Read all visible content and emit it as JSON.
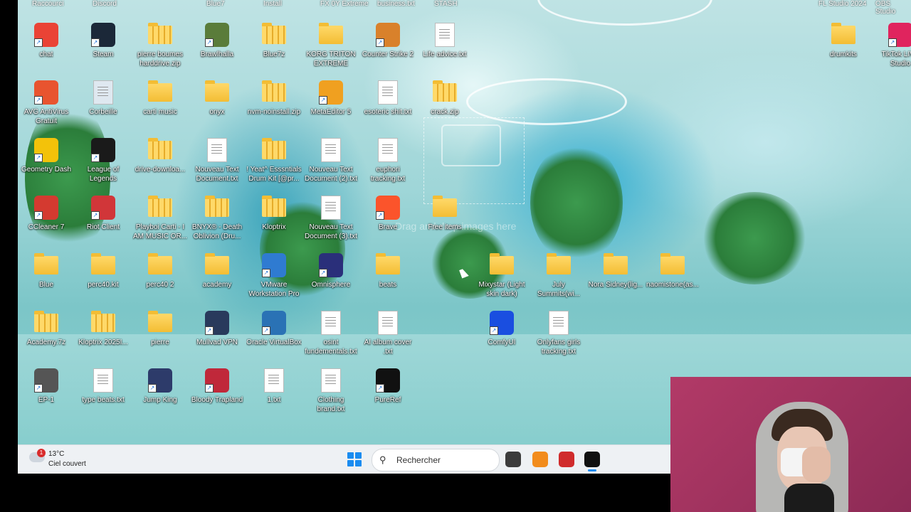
{
  "desktop": {
    "partial_top_labels": [
      {
        "text": "Raccourci"
      },
      {
        "text": "Discord"
      },
      {
        "text": "Blue7"
      },
      {
        "text": "Install"
      },
      {
        "text": "FX 0Y Extreme"
      },
      {
        "text": "business.txt"
      },
      {
        "text": "STASH"
      },
      {
        "text": "FL Studio 2024"
      },
      {
        "text": "OBS Studio"
      }
    ],
    "icons": [
      {
        "label": "chat",
        "type": "app",
        "color": "#ea4335"
      },
      {
        "label": "Steam",
        "type": "app",
        "color": "#1b2838"
      },
      {
        "label": "pierre boumes harddrive.zip",
        "type": "zip"
      },
      {
        "label": "Brawlhalla",
        "type": "app",
        "color": "#5a7c3a"
      },
      {
        "label": "Blue7z",
        "type": "zip"
      },
      {
        "label": "KORG TRITON EXTREME v1.0...",
        "type": "folder"
      },
      {
        "label": "Counter Strike 2",
        "type": "app",
        "color": "#d9812b"
      },
      {
        "label": "Life advice.txt",
        "type": "txt"
      },
      {
        "label": "drumkits",
        "type": "folder"
      },
      {
        "label": "TikTok LIVE Studio",
        "type": "app",
        "color": "#e0245e"
      },
      {
        "label": "AVG AntiVirus Gratuit",
        "type": "app",
        "color": "#e8542f"
      },
      {
        "label": "Corbeille",
        "type": "bin"
      },
      {
        "label": "carti music",
        "type": "folder"
      },
      {
        "label": "onyx",
        "type": "folder"
      },
      {
        "label": "nvm-noinstall.zip",
        "type": "zip"
      },
      {
        "label": "MetaEditor 5",
        "type": "app",
        "color": "#f0a020"
      },
      {
        "label": "esoteric shit.txt",
        "type": "txt"
      },
      {
        "label": "crack.zip",
        "type": "zip"
      },
      {
        "label": "Geometry Dash",
        "type": "app",
        "color": "#f3c20a"
      },
      {
        "label": "League of Legends",
        "type": "app",
        "color": "#1a1a1a"
      },
      {
        "label": "drive-downloa...",
        "type": "zip"
      },
      {
        "label": "Nouveau Text Document.txt",
        "type": "txt"
      },
      {
        "label": "! Yeat^ Esssntials Drum Kit [@pr...",
        "type": "zip"
      },
      {
        "label": "Nouveau Text Document (2).txt",
        "type": "txt"
      },
      {
        "label": "euphori tracking.txt",
        "type": "txt"
      },
      {
        "label": "CCleaner 7",
        "type": "app",
        "color": "#d43a30"
      },
      {
        "label": "Riot Client",
        "type": "app",
        "color": "#d13639"
      },
      {
        "label": "Playboi Carti - I AM MUSIC OR...",
        "type": "zip"
      },
      {
        "label": "BNYX® - Death Oblivion (Dru...",
        "type": "zip"
      },
      {
        "label": "Kloptrix",
        "type": "zip"
      },
      {
        "label": "Nouveau Text Document (3).txt",
        "type": "txt"
      },
      {
        "label": "Brave",
        "type": "app",
        "color": "#fb542b"
      },
      {
        "label": "Free items",
        "type": "folder"
      },
      {
        "label": "Blue",
        "type": "folder"
      },
      {
        "label": "perc40.kit",
        "type": "folder"
      },
      {
        "label": "perc40 2",
        "type": "folder"
      },
      {
        "label": "academy",
        "type": "folder"
      },
      {
        "label": "VMware Workstation Pro",
        "type": "app",
        "color": "#2f7bd1"
      },
      {
        "label": "Omnisphere",
        "type": "app",
        "color": "#2a2f7a"
      },
      {
        "label": "beats",
        "type": "folder"
      },
      {
        "label": "Mixystar (Light skin dark)",
        "type": "folder"
      },
      {
        "label": "July Summits(wi...",
        "type": "folder"
      },
      {
        "label": "Nora Sidney(lig...",
        "type": "folder"
      },
      {
        "label": "naomistone(as...",
        "type": "folder"
      },
      {
        "label": "Academy.7z",
        "type": "zip"
      },
      {
        "label": "Kloptrix 2025I...",
        "type": "zip"
      },
      {
        "label": "pierre",
        "type": "folder"
      },
      {
        "label": "Mullvad VPN",
        "type": "app",
        "color": "#293a5c"
      },
      {
        "label": "Oracle VirtualBox",
        "type": "app",
        "color": "#2a72b5"
      },
      {
        "label": "osint fundementals.txt",
        "type": "txt"
      },
      {
        "label": "AI album cover .txt",
        "type": "txt"
      },
      {
        "label": "ComfyUI",
        "type": "app",
        "color": "#1a4ee0"
      },
      {
        "label": "Onlyfans girls tracking.txt",
        "type": "txt"
      },
      {
        "label": "EP-1",
        "type": "app",
        "color": "#555555"
      },
      {
        "label": "type beats.txt",
        "type": "txt"
      },
      {
        "label": "Jump King",
        "type": "app",
        "color": "#2d3b6a"
      },
      {
        "label": "Bloody Trapland",
        "type": "app",
        "color": "#c0283a"
      },
      {
        "label": "1.txt",
        "type": "txt"
      },
      {
        "label": "Clothing brand.txt",
        "type": "txt"
      },
      {
        "label": "PureRef",
        "type": "app",
        "color": "#111111"
      }
    ],
    "drop_overlay": {
      "text": "Drag and drop images here",
      "browse": "Browse"
    }
  },
  "taskbar": {
    "weather": {
      "temp": "13°C",
      "condition": "Ciel couvert",
      "badge": "1"
    },
    "search_placeholder": "Rechercher",
    "apps": [
      {
        "name": "file-explorer",
        "color": "#3c3c3c"
      },
      {
        "name": "fl-studio",
        "color": "#f28c1c"
      },
      {
        "name": "davinci",
        "color": "#d02c2c"
      },
      {
        "name": "pureref",
        "color": "#111111"
      }
    ]
  },
  "colors": {
    "accent": "#1a8cf0"
  }
}
